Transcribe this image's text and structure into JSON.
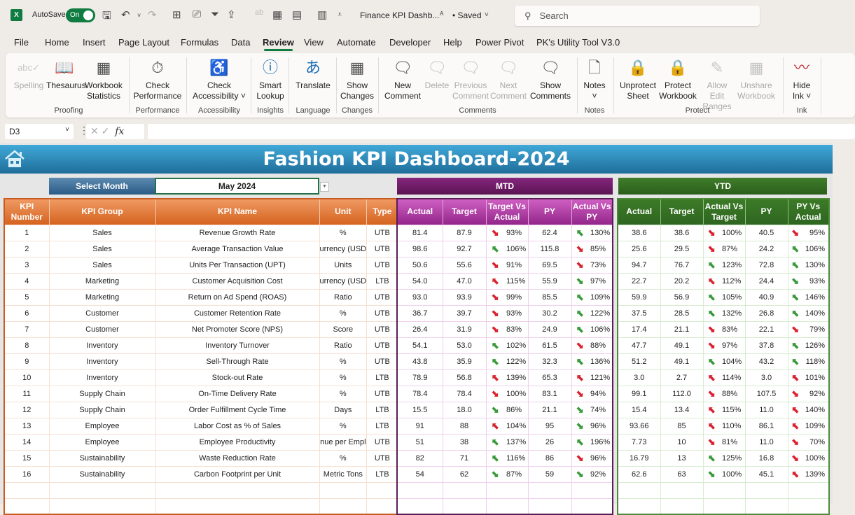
{
  "titlebar": {
    "autosave_label": "AutoSave",
    "autosave_state": "On",
    "document_title": "Finance KPI Dashb...",
    "saved_status": "• Saved",
    "search_placeholder": "Search"
  },
  "menu": {
    "tabs": [
      "File",
      "Home",
      "Insert",
      "Page Layout",
      "Formulas",
      "Data",
      "Review",
      "View",
      "Automate",
      "Developer",
      "Help",
      "Power Pivot",
      "PK's Utility Tool V3.0"
    ],
    "active": "Review"
  },
  "ribbon": {
    "buttons": [
      {
        "label": "Spelling",
        "icon": "spelling-icon",
        "disabled": true
      },
      {
        "label": "Thesaurus",
        "icon": "thesaurus-icon",
        "disabled": false
      },
      {
        "label": "Workbook Statistics",
        "icon": "workbook-statistics-icon",
        "disabled": false
      },
      {
        "label": "Check Performance",
        "icon": "check-performance-icon",
        "disabled": false
      },
      {
        "label": "Check Accessibility ˅",
        "icon": "check-accessibility-icon",
        "disabled": false
      },
      {
        "label": "Smart Lookup",
        "icon": "smart-lookup-icon",
        "disabled": false
      },
      {
        "label": "Translate",
        "icon": "translate-icon",
        "disabled": false
      },
      {
        "label": "Show Changes",
        "icon": "show-changes-icon",
        "disabled": false
      },
      {
        "label": "New Comment",
        "icon": "new-comment-icon",
        "disabled": false
      },
      {
        "label": "Delete",
        "icon": "delete-comment-icon",
        "disabled": true
      },
      {
        "label": "Previous Comment",
        "icon": "previous-comment-icon",
        "disabled": true
      },
      {
        "label": "Next Comment",
        "icon": "next-comment-icon",
        "disabled": true
      },
      {
        "label": "Show Comments",
        "icon": "show-comments-icon",
        "disabled": false
      },
      {
        "label": "Notes ˅",
        "icon": "notes-icon",
        "disabled": false
      },
      {
        "label": "Unprotect Sheet",
        "icon": "unprotect-sheet-icon",
        "disabled": false
      },
      {
        "label": "Protect Workbook",
        "icon": "protect-workbook-icon",
        "disabled": false
      },
      {
        "label": "Allow Edit Ranges",
        "icon": "allow-edit-ranges-icon",
        "disabled": true
      },
      {
        "label": "Unshare Workbook",
        "icon": "unshare-workbook-icon",
        "disabled": true
      },
      {
        "label": "Hide Ink ˅",
        "icon": "hide-ink-icon",
        "disabled": false
      }
    ],
    "groups": [
      "Proofing",
      "Performance",
      "Accessibility",
      "Insights",
      "Language",
      "Changes",
      "Comments",
      "Notes",
      "Protect",
      "Ink"
    ]
  },
  "formula_bar": {
    "name_box": "D3",
    "formula": ""
  },
  "dashboard": {
    "title": "Fashion KPI Dashboard-2024",
    "select_month_label": "Select Month",
    "selected_month": "May 2024",
    "mtd_label": "MTD",
    "ytd_label": "YTD",
    "colors": {
      "up_good": "#3a9a3a",
      "bad": "#d9232e",
      "banner": "#2a88bd",
      "mtd": "#7a1f70",
      "ytd": "#356e22",
      "kpi_header": "#e2783c"
    },
    "kpi_headers": [
      "KPI Number",
      "KPI Group",
      "KPI Name",
      "Unit",
      "Type"
    ],
    "mtd_headers": [
      "Actual",
      "Target",
      "Target Vs Actual",
      "PY",
      "Actual Vs PY"
    ],
    "ytd_headers": [
      "Actual",
      "Target",
      "Actual Vs Target",
      "PY",
      "PY Vs Actual"
    ],
    "rows": [
      {
        "num": "1",
        "group": "Sales",
        "name": "Revenue Growth Rate",
        "unit": "%",
        "type": "UTB",
        "mtd": {
          "actual": "81.4",
          "target": "87.9",
          "tva_dir": "down",
          "tva_color": "red",
          "tva": "93%",
          "py": "62.4",
          "avp_dir": "up",
          "avp_color": "green",
          "avp": "130%"
        },
        "ytd": {
          "actual": "38.6",
          "target": "38.6",
          "avt_dir": "down",
          "avt_color": "red",
          "avt": "100%",
          "py": "40.5",
          "pva_dir": "down",
          "pva_color": "red",
          "pva": "95%"
        }
      },
      {
        "num": "2",
        "group": "Sales",
        "name": "Average Transaction Value",
        "unit": "urrency (USD",
        "type": "UTB",
        "mtd": {
          "actual": "98.6",
          "target": "92.7",
          "tva_dir": "up",
          "tva_color": "green",
          "tva": "106%",
          "py": "115.8",
          "avp_dir": "down",
          "avp_color": "red",
          "avp": "85%"
        },
        "ytd": {
          "actual": "25.6",
          "target": "29.5",
          "avt_dir": "down",
          "avt_color": "red",
          "avt": "87%",
          "py": "24.2",
          "pva_dir": "up",
          "pva_color": "green",
          "pva": "106%"
        }
      },
      {
        "num": "3",
        "group": "Sales",
        "name": "Units Per Transaction (UPT)",
        "unit": "Units",
        "type": "UTB",
        "mtd": {
          "actual": "50.6",
          "target": "55.6",
          "tva_dir": "down",
          "tva_color": "red",
          "tva": "91%",
          "py": "69.5",
          "avp_dir": "down",
          "avp_color": "red",
          "avp": "73%"
        },
        "ytd": {
          "actual": "94.7",
          "target": "76.7",
          "avt_dir": "up",
          "avt_color": "green",
          "avt": "123%",
          "py": "72.8",
          "pva_dir": "up",
          "pva_color": "green",
          "pva": "130%"
        }
      },
      {
        "num": "4",
        "group": "Marketing",
        "name": "Customer Acquisition Cost",
        "unit": "urrency (USD",
        "type": "LTB",
        "mtd": {
          "actual": "54.0",
          "target": "47.0",
          "tva_dir": "up",
          "tva_color": "red",
          "tva": "115%",
          "py": "55.9",
          "avp_dir": "down",
          "avp_color": "green",
          "avp": "97%"
        },
        "ytd": {
          "actual": "22.7",
          "target": "20.2",
          "avt_dir": "up",
          "avt_color": "red",
          "avt": "112%",
          "py": "24.4",
          "pva_dir": "down",
          "pva_color": "green",
          "pva": "93%"
        }
      },
      {
        "num": "5",
        "group": "Marketing",
        "name": "Return on Ad Spend (ROAS)",
        "unit": "Ratio",
        "type": "UTB",
        "mtd": {
          "actual": "93.0",
          "target": "93.9",
          "tva_dir": "down",
          "tva_color": "red",
          "tva": "99%",
          "py": "85.5",
          "avp_dir": "up",
          "avp_color": "green",
          "avp": "109%"
        },
        "ytd": {
          "actual": "59.9",
          "target": "56.9",
          "avt_dir": "up",
          "avt_color": "green",
          "avt": "105%",
          "py": "40.9",
          "pva_dir": "up",
          "pva_color": "green",
          "pva": "146%"
        }
      },
      {
        "num": "6",
        "group": "Customer",
        "name": "Customer Retention Rate",
        "unit": "%",
        "type": "UTB",
        "mtd": {
          "actual": "36.7",
          "target": "39.7",
          "tva_dir": "down",
          "tva_color": "red",
          "tva": "93%",
          "py": "30.2",
          "avp_dir": "up",
          "avp_color": "green",
          "avp": "122%"
        },
        "ytd": {
          "actual": "37.5",
          "target": "28.5",
          "avt_dir": "up",
          "avt_color": "green",
          "avt": "132%",
          "py": "26.8",
          "pva_dir": "up",
          "pva_color": "green",
          "pva": "140%"
        }
      },
      {
        "num": "7",
        "group": "Customer",
        "name": "Net Promoter Score (NPS)",
        "unit": "Score",
        "type": "UTB",
        "mtd": {
          "actual": "26.4",
          "target": "31.9",
          "tva_dir": "down",
          "tva_color": "red",
          "tva": "83%",
          "py": "24.9",
          "avp_dir": "up",
          "avp_color": "green",
          "avp": "106%"
        },
        "ytd": {
          "actual": "17.4",
          "target": "21.1",
          "avt_dir": "down",
          "avt_color": "red",
          "avt": "83%",
          "py": "22.1",
          "pva_dir": "down",
          "pva_color": "red",
          "pva": "79%"
        }
      },
      {
        "num": "8",
        "group": "Inventory",
        "name": "Inventory Turnover",
        "unit": "Ratio",
        "type": "UTB",
        "mtd": {
          "actual": "54.1",
          "target": "53.0",
          "tva_dir": "up",
          "tva_color": "green",
          "tva": "102%",
          "py": "61.5",
          "avp_dir": "down",
          "avp_color": "red",
          "avp": "88%"
        },
        "ytd": {
          "actual": "47.7",
          "target": "49.1",
          "avt_dir": "down",
          "avt_color": "red",
          "avt": "97%",
          "py": "37.8",
          "pva_dir": "up",
          "pva_color": "green",
          "pva": "126%"
        }
      },
      {
        "num": "9",
        "group": "Inventory",
        "name": "Sell-Through Rate",
        "unit": "%",
        "type": "UTB",
        "mtd": {
          "actual": "43.8",
          "target": "35.9",
          "tva_dir": "up",
          "tva_color": "green",
          "tva": "122%",
          "py": "32.3",
          "avp_dir": "up",
          "avp_color": "green",
          "avp": "136%"
        },
        "ytd": {
          "actual": "51.2",
          "target": "49.1",
          "avt_dir": "up",
          "avt_color": "green",
          "avt": "104%",
          "py": "43.2",
          "pva_dir": "up",
          "pva_color": "green",
          "pva": "118%"
        }
      },
      {
        "num": "10",
        "group": "Inventory",
        "name": "Stock-out Rate",
        "unit": "%",
        "type": "LTB",
        "mtd": {
          "actual": "78.9",
          "target": "56.8",
          "tva_dir": "up",
          "tva_color": "red",
          "tva": "139%",
          "py": "65.3",
          "avp_dir": "up",
          "avp_color": "red",
          "avp": "121%"
        },
        "ytd": {
          "actual": "3.0",
          "target": "2.7",
          "avt_dir": "up",
          "avt_color": "red",
          "avt": "114%",
          "py": "3.0",
          "pva_dir": "up",
          "pva_color": "red",
          "pva": "101%"
        }
      },
      {
        "num": "11",
        "group": "Supply Chain",
        "name": "On-Time Delivery Rate",
        "unit": "%",
        "type": "UTB",
        "mtd": {
          "actual": "78.4",
          "target": "78.4",
          "tva_dir": "down",
          "tva_color": "red",
          "tva": "100%",
          "py": "83.1",
          "avp_dir": "down",
          "avp_color": "red",
          "avp": "94%"
        },
        "ytd": {
          "actual": "99.1",
          "target": "112.0",
          "avt_dir": "down",
          "avt_color": "red",
          "avt": "88%",
          "py": "107.5",
          "pva_dir": "down",
          "pva_color": "red",
          "pva": "92%"
        }
      },
      {
        "num": "12",
        "group": "Supply Chain",
        "name": "Order Fulfillment Cycle Time",
        "unit": "Days",
        "type": "LTB",
        "mtd": {
          "actual": "15.5",
          "target": "18.0",
          "tva_dir": "down",
          "tva_color": "green",
          "tva": "86%",
          "py": "21.1",
          "avp_dir": "down",
          "avp_color": "green",
          "avp": "74%"
        },
        "ytd": {
          "actual": "15.4",
          "target": "13.4",
          "avt_dir": "up",
          "avt_color": "red",
          "avt": "115%",
          "py": "11.0",
          "pva_dir": "up",
          "pva_color": "red",
          "pva": "140%"
        }
      },
      {
        "num": "13",
        "group": "Employee",
        "name": "Labor Cost as % of Sales",
        "unit": "%",
        "type": "LTB",
        "mtd": {
          "actual": "91",
          "target": "88",
          "tva_dir": "up",
          "tva_color": "red",
          "tva": "104%",
          "py": "95",
          "avp_dir": "down",
          "avp_color": "green",
          "avp": "96%"
        },
        "ytd": {
          "actual": "93.66",
          "target": "85",
          "avt_dir": "up",
          "avt_color": "red",
          "avt": "110%",
          "py": "86.1",
          "pva_dir": "up",
          "pva_color": "red",
          "pva": "109%"
        }
      },
      {
        "num": "14",
        "group": "Employee",
        "name": "Employee Productivity",
        "unit": "nue per Empl",
        "type": "UTB",
        "mtd": {
          "actual": "51",
          "target": "38",
          "tva_dir": "up",
          "tva_color": "green",
          "tva": "137%",
          "py": "26",
          "avp_dir": "up",
          "avp_color": "green",
          "avp": "196%"
        },
        "ytd": {
          "actual": "7.73",
          "target": "10",
          "avt_dir": "down",
          "avt_color": "red",
          "avt": "81%",
          "py": "11.0",
          "pva_dir": "down",
          "pva_color": "red",
          "pva": "70%"
        }
      },
      {
        "num": "15",
        "group": "Sustainability",
        "name": "Waste Reduction Rate",
        "unit": "%",
        "type": "UTB",
        "mtd": {
          "actual": "82",
          "target": "71",
          "tva_dir": "up",
          "tva_color": "green",
          "tva": "116%",
          "py": "86",
          "avp_dir": "down",
          "avp_color": "red",
          "avp": "96%"
        },
        "ytd": {
          "actual": "16.79",
          "target": "13",
          "avt_dir": "up",
          "avt_color": "green",
          "avt": "125%",
          "py": "16.8",
          "pva_dir": "down",
          "pva_color": "red",
          "pva": "100%"
        }
      },
      {
        "num": "16",
        "group": "Sustainability",
        "name": "Carbon Footprint per Unit",
        "unit": "Metric Tons",
        "type": "LTB",
        "mtd": {
          "actual": "54",
          "target": "62",
          "tva_dir": "down",
          "tva_color": "green",
          "tva": "87%",
          "py": "59",
          "avp_dir": "down",
          "avp_color": "green",
          "avp": "92%"
        },
        "ytd": {
          "actual": "62.6",
          "target": "63",
          "avt_dir": "down",
          "avt_color": "green",
          "avt": "100%",
          "py": "45.1",
          "pva_dir": "up",
          "pva_color": "red",
          "pva": "139%"
        }
      }
    ]
  }
}
